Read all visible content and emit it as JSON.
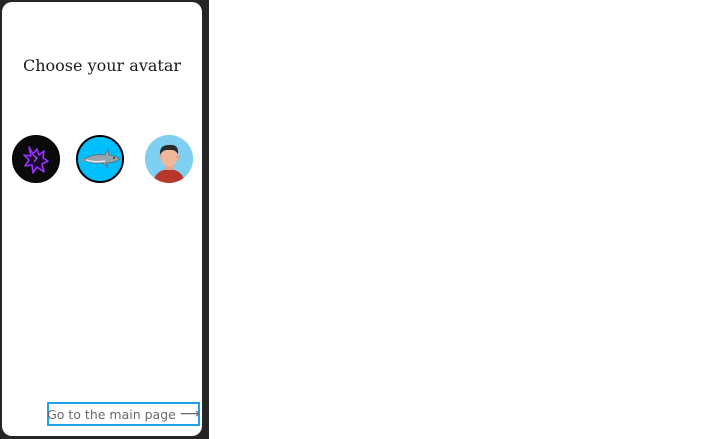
{
  "title": "Choose your avatar",
  "avatars": [
    {
      "name": "wolf",
      "bg": "#0a0a0a",
      "accent": "#8a2be2"
    },
    {
      "name": "shark",
      "bg": "#00bfff",
      "accent": "#9aa4ad"
    },
    {
      "name": "person",
      "bg": "#7ecff0",
      "accent": "#c0392b"
    }
  ],
  "go_button": {
    "label": "Go to the main page",
    "arrow": "⟶"
  },
  "colors": {
    "frame": "#252525",
    "accent": "#1fa3e8"
  }
}
